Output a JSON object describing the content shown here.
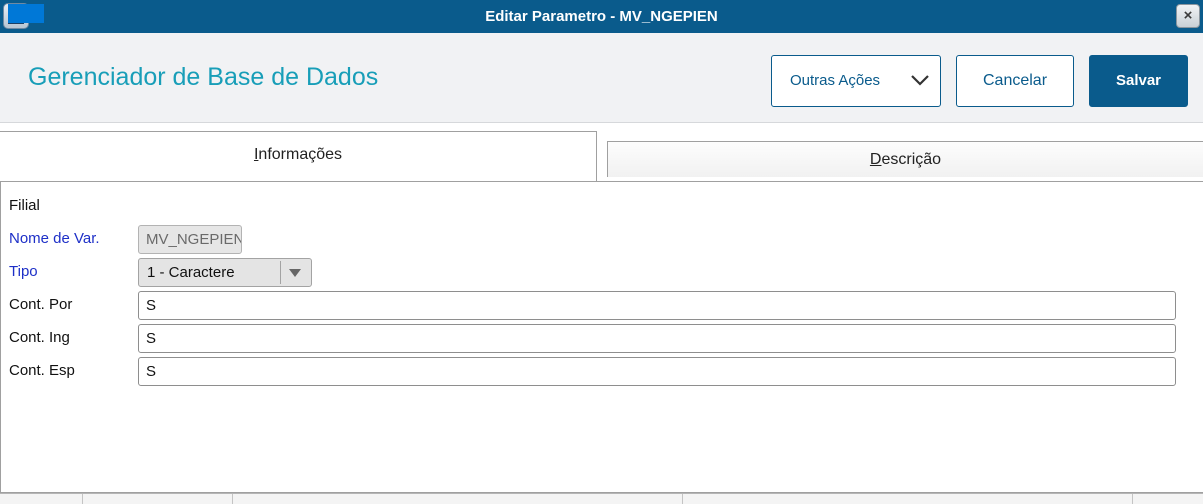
{
  "window": {
    "title": "Editar Parametro - MV_NGEPIEN",
    "close_label": "×"
  },
  "header": {
    "title": "Gerenciador de Base de Dados",
    "other_actions_label": "Outras Ações",
    "cancel_label": "Cancelar",
    "save_label": "Salvar"
  },
  "tabs": [
    {
      "label_first": "I",
      "label_rest": "nformações",
      "active": true
    },
    {
      "label_first": "D",
      "label_rest": "escrição",
      "active": false
    }
  ],
  "form": {
    "filial_label": "Filial",
    "nome_label": "Nome de Var.",
    "nome_value": "MV_NGEPIEN",
    "tipo_label": "Tipo",
    "tipo_value": "1 - Caractere",
    "cont_por_label": "Cont. Por",
    "cont_por_value": "S",
    "cont_ing_label": "Cont. Ing",
    "cont_ing_value": "S",
    "cont_esp_label": "Cont. Esp",
    "cont_esp_value": "S"
  },
  "colors": {
    "title_bar": "#0a5b8c",
    "page_title": "#189eb8",
    "label_blue": "#1d2fc7",
    "selection": "#0078d7"
  }
}
